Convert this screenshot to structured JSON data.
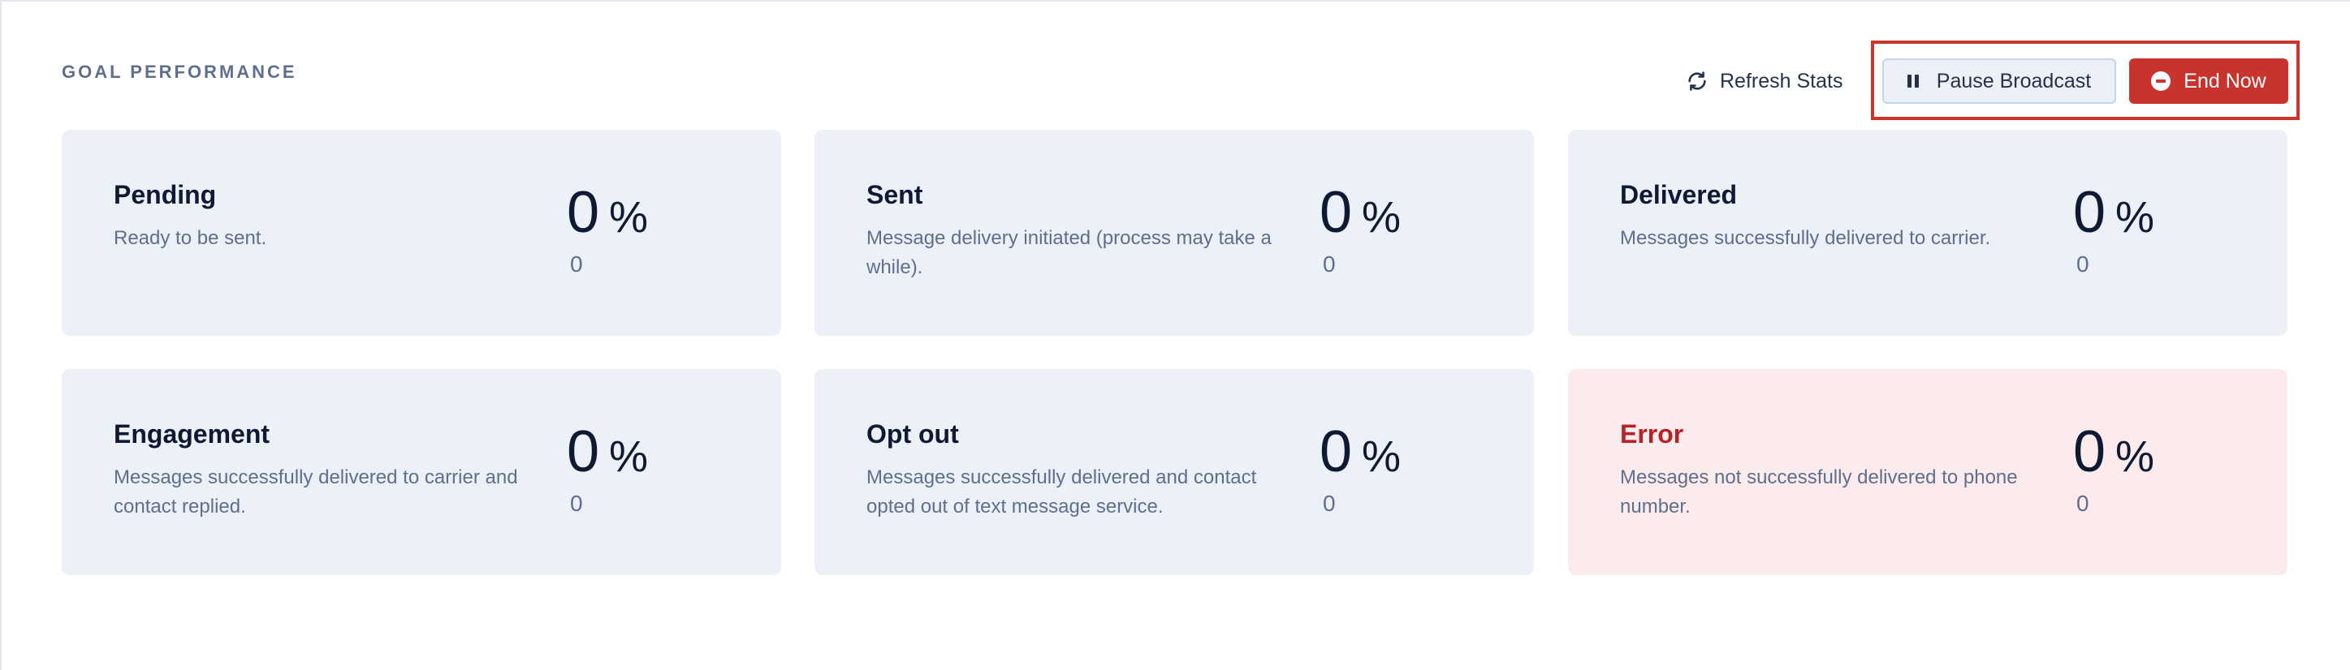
{
  "section": {
    "title": "GOAL PERFORMANCE"
  },
  "actions": {
    "refresh_label": "Refresh Stats",
    "pause_label": "Pause Broadcast",
    "end_label": "End Now"
  },
  "cards": [
    {
      "title": "Pending",
      "description": "Ready to be sent.",
      "percent": "0",
      "percent_symbol": "%",
      "count": "0"
    },
    {
      "title": "Sent",
      "description": "Message delivery initiated (process may take a while).",
      "percent": "0",
      "percent_symbol": "%",
      "count": "0"
    },
    {
      "title": "Delivered",
      "description": "Messages successfully delivered to carrier.",
      "percent": "0",
      "percent_symbol": "%",
      "count": "0"
    },
    {
      "title": "Engagement",
      "description": "Messages successfully delivered to carrier and contact replied.",
      "percent": "0",
      "percent_symbol": "%",
      "count": "0"
    },
    {
      "title": "Opt out",
      "description": "Messages successfully delivered and contact opted out of text message service.",
      "percent": "0",
      "percent_symbol": "%",
      "count": "0"
    },
    {
      "title": "Error",
      "description": "Messages not successfully delivered to phone number.",
      "percent": "0",
      "percent_symbol": "%",
      "count": "0"
    }
  ],
  "colors": {
    "accent_danger": "#c8332d",
    "card_bg": "#ecf0f7",
    "error_card_bg": "#fbebec",
    "error_title": "#b52424"
  },
  "icons": {
    "refresh": "refresh-icon",
    "pause": "pause-icon",
    "end": "minus-circle-icon"
  }
}
